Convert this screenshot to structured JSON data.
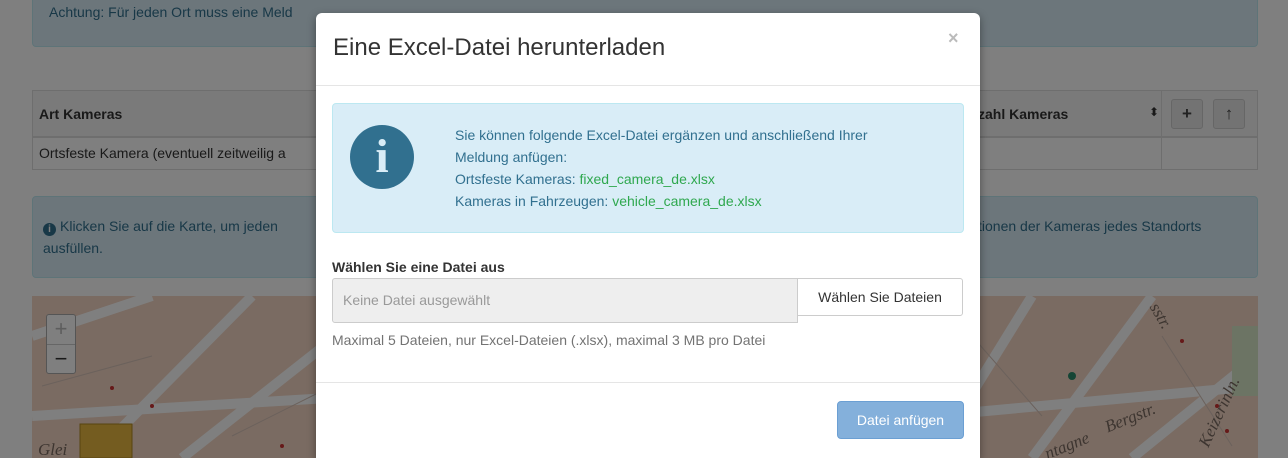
{
  "background": {
    "alert_top_text": "Achtung: Für jeden Ort muss eine Meld",
    "table": {
      "col_type_header": "Art Kameras",
      "col_count_header": "zahl Kameras",
      "sort_icon": "⬍",
      "add_button": "+",
      "up_button": "↑",
      "row_type_value": "Ortsfeste Kamera (eventuell zeitweilig a"
    },
    "info_left": "Klicken Sie auf die Karte, um jeden",
    "info_left_2": "ausfüllen.",
    "info_right": "tionen der Kameras jedes Standorts",
    "map": {
      "zoom_in": "+",
      "zoom_out": "−",
      "labels": [
        "Bergstr.",
        "ntagne",
        "Keizerinln.",
        "sstr.",
        "Glei"
      ]
    }
  },
  "modal": {
    "title": "Eine Excel-Datei herunterladen",
    "close": "×",
    "info_icon": "i",
    "info_line1": "Sie können folgende Excel-Datei ergänzen und anschließend Ihrer",
    "info_line2": "Meldung anfügen:",
    "fixed_label": "Ortsfeste Kameras: ",
    "fixed_file": "fixed_camera_de.xlsx",
    "vehicle_label": "Kameras in Fahrzeugen: ",
    "vehicle_file": "vehicle_camera_de.xlsx",
    "file_label": "Wählen Sie eine Datei aus",
    "file_placeholder": "Keine Datei ausgewählt",
    "choose_button": "Wählen Sie Dateien",
    "help_text": "Maximal 5 Dateien, nur Excel-Dateien (.xlsx), maximal 3 MB pro Datei",
    "attach_button": "Datei anfügen"
  }
}
